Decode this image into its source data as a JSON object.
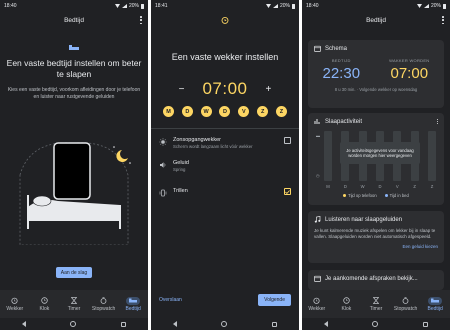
{
  "status": {
    "time1": "18:40",
    "time2": "18:41",
    "time3": "18:40",
    "battery": "20%"
  },
  "tabs": [
    {
      "label": "Wekker",
      "icon": "alarm-icon"
    },
    {
      "label": "Klok",
      "icon": "clock-icon"
    },
    {
      "label": "Timer",
      "icon": "hourglass-icon"
    },
    {
      "label": "Stopwatch",
      "icon": "stopwatch-icon"
    },
    {
      "label": "Bedtijd",
      "icon": "bed-icon"
    }
  ],
  "screen1": {
    "title": "Bedtijd",
    "heading": "Een vaste bedtijd instellen om beter te slapen",
    "body": "Kies een vaste bedtijd, voorkom afleidingen door je telefoon en luister naar rustgevende geluiden",
    "button": "Aan de slag"
  },
  "screen2": {
    "heading": "Een vaste wekker instellen",
    "minus": "−",
    "plus": "+",
    "time": "07:00",
    "days": [
      "M",
      "D",
      "W",
      "D",
      "V",
      "Z",
      "Z"
    ],
    "options": [
      {
        "title": "Zonsopgangwekker",
        "sub": "Scherm wordt langzaam licht vóór wekker",
        "checked": false,
        "icon": "sunrise-icon"
      },
      {
        "title": "Geluid",
        "sub": "Spring",
        "checked": null,
        "icon": "sound-icon"
      },
      {
        "title": "Trillen",
        "sub": "",
        "checked": true,
        "icon": "vibrate-icon"
      }
    ],
    "skip": "Overslaan",
    "next": "Volgende"
  },
  "screen3": {
    "title": "Bedtijd",
    "schedule": {
      "heading": "Schema",
      "bedtime_label": "BEDTIJD",
      "bedtime": "22:30",
      "wake_label": "WAKKER WORDEN",
      "wake": "07:00",
      "note": "8 u 30 min. · Volgende wekker op woensdag"
    },
    "sleep": {
      "heading": "Slaapactiviteit",
      "overlay": "Je activiteitsgegevens voor vandaag worden morgen hier weergegeven",
      "days": [
        "M",
        "D",
        "W",
        "D",
        "V",
        "Z",
        "Z"
      ],
      "legend_phone": "Tijd op telefoon",
      "legend_bed": "Tijd in bed",
      "colors": {
        "phone": "#fdd663",
        "bed": "#8ab4f8"
      }
    },
    "sounds": {
      "heading": "Luisteren naar slaapgeluiden",
      "body": "Je kunt kalmerende muziek afspelen om lekker bij in slaap te vallen. Slaapgeluiden worden niet automatisch afgespeeld.",
      "link": "Een geluid kiezen"
    },
    "events": {
      "heading": "Je aankomende afspraken bekijk..."
    }
  }
}
